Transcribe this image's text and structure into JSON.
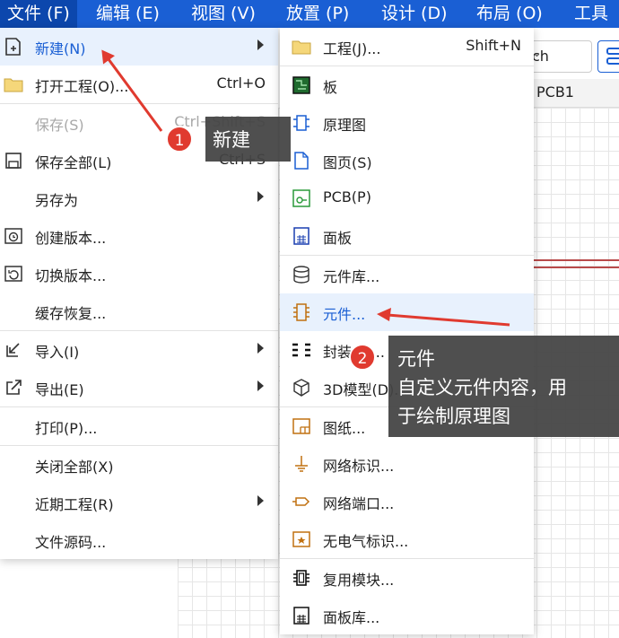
{
  "menubar": {
    "items": [
      {
        "label": "文件 (F)"
      },
      {
        "label": "编辑 (E)"
      },
      {
        "label": "视图 (V)"
      },
      {
        "label": "放置 (P)"
      },
      {
        "label": "设计 (D)"
      },
      {
        "label": "布局 (O)"
      },
      {
        "label": "工具"
      }
    ]
  },
  "toolbar": {
    "combo_value": "ch"
  },
  "tabs": {
    "active_tab": "PCB1"
  },
  "file_menu": {
    "items": [
      {
        "label": "新建(N)",
        "has_submenu": true,
        "icon": "new-file-icon"
      },
      {
        "label": "打开工程(O)...",
        "shortcut": "Ctrl+O",
        "icon": "folder-icon"
      },
      {
        "label": "保存(S)",
        "shortcut": "Ctrl+Shift+S",
        "disabled": true
      },
      {
        "label": "保存全部(L)",
        "shortcut": "Ctrl+S",
        "icon": "save-icon"
      },
      {
        "label": "另存为",
        "has_submenu": true
      },
      {
        "label": "创建版本...",
        "icon": "create-version-icon"
      },
      {
        "label": "切换版本...",
        "icon": "switch-version-icon"
      },
      {
        "label": "缓存恢复..."
      },
      {
        "label": "导入(I)",
        "has_submenu": true,
        "icon": "import-icon"
      },
      {
        "label": "导出(E)",
        "has_submenu": true,
        "icon": "export-icon"
      },
      {
        "label": "打印(P)..."
      },
      {
        "label": "关闭全部(X)"
      },
      {
        "label": "近期工程(R)",
        "has_submenu": true
      },
      {
        "label": "文件源码..."
      }
    ]
  },
  "new_submenu": {
    "items": [
      {
        "label": "工程(J)...",
        "shortcut": "Shift+N",
        "icon": "project-folder-icon"
      },
      {
        "label": "板",
        "icon": "board-icon"
      },
      {
        "label": "原理图",
        "icon": "schematic-icon"
      },
      {
        "label": "图页(S)",
        "icon": "page-icon"
      },
      {
        "label": "PCB(P)",
        "icon": "pcb-icon"
      },
      {
        "label": "面板",
        "icon": "panel-icon"
      },
      {
        "label": "元件库...",
        "icon": "library-icon"
      },
      {
        "label": "元件...",
        "icon": "component-icon"
      },
      {
        "label": "封装(F)...",
        "icon": "footprint-icon"
      },
      {
        "label": "3D模型(D)...",
        "icon": "3d-model-icon"
      },
      {
        "label": "图纸...",
        "icon": "drawing-sheet-icon"
      },
      {
        "label": "网络标识...",
        "icon": "net-label-icon"
      },
      {
        "label": "网络端口...",
        "icon": "net-port-icon"
      },
      {
        "label": "无电气标识...",
        "icon": "non-electrical-icon"
      },
      {
        "label": "复用模块...",
        "icon": "reuse-module-icon"
      },
      {
        "label": "面板库...",
        "icon": "panel-library-icon"
      }
    ]
  },
  "annotations": {
    "badge1": "1",
    "callout1": "新建",
    "badge2": "2",
    "callout2_title": "元件",
    "callout2_line1": "自定义元件内容，用",
    "callout2_line2": "于绘制原理图"
  },
  "colors": {
    "menubar": "#1a5fd4",
    "highlight": "#e8f1fd",
    "annotation_red": "#e03a2f",
    "callout_bg": "#444444"
  }
}
